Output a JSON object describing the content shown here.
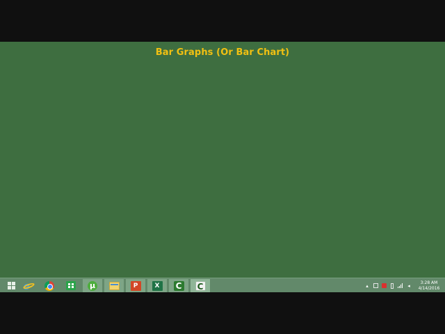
{
  "slide": {
    "title": "Bar Graphs (Or Bar Chart)",
    "title_color": "#f2c012",
    "background_color": "#3e6e40"
  },
  "taskbar": {
    "color": "#62896a",
    "items": [
      {
        "name": "start",
        "icon": "windows-start-icon"
      },
      {
        "name": "internet-explorer",
        "icon": "internet-explorer-icon",
        "glyph": "e"
      },
      {
        "name": "chrome",
        "icon": "chrome-icon"
      },
      {
        "name": "windows-store",
        "icon": "store-icon"
      },
      {
        "name": "utorrent",
        "icon": "utorrent-icon",
        "glyph": "µ"
      },
      {
        "name": "file-explorer",
        "icon": "folder-icon"
      },
      {
        "name": "powerpoint",
        "icon": "powerpoint-icon",
        "glyph": "P"
      },
      {
        "name": "excel",
        "icon": "excel-icon",
        "glyph": "X"
      },
      {
        "name": "camtasia-recorder",
        "icon": "camtasia-icon",
        "glyph": "C"
      },
      {
        "name": "camtasia-studio",
        "icon": "camtasia-icon",
        "glyph": "C"
      }
    ],
    "tray": {
      "show_hidden": "▴",
      "time": "3:28 AM",
      "date": "4/14/2016"
    }
  }
}
